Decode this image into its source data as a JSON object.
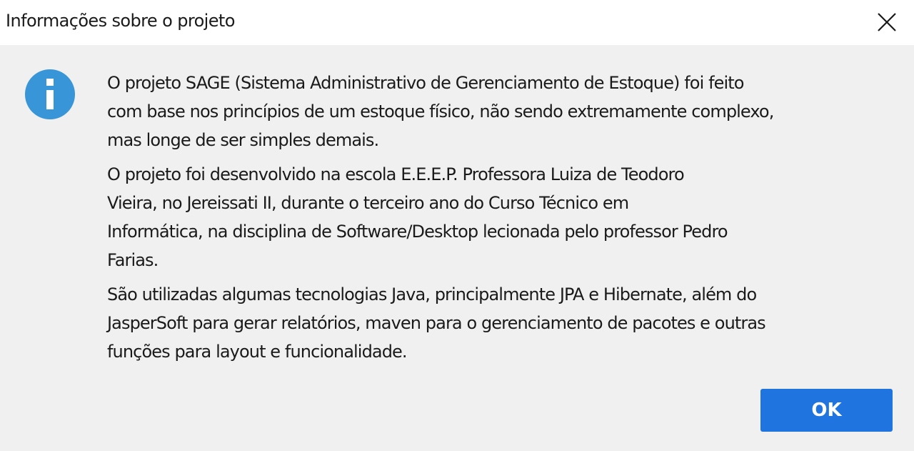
{
  "window": {
    "title": "Informações sobre o projeto"
  },
  "icons": {
    "close": "close-icon",
    "info": "info-icon"
  },
  "colors": {
    "info_icon": "#3795d8",
    "button": "#1f74e0",
    "background": "#f0f0f0",
    "titlebar": "#ffffff"
  },
  "message": {
    "paragraphs": [
      {
        "lines": [
          "O projeto SAGE (Sistema Administrativo de Gerenciamento de Estoque) foi feito",
          "com base nos princípios de um estoque físico, não sendo extremamente complexo,",
          "mas longe de ser simples demais."
        ]
      },
      {
        "lines": [
          "O projeto foi desenvolvido na escola E.E.E.P. Professora Luiza de Teodoro",
          "Vieira, no Jereissati II, durante o terceiro ano do Curso Técnico em",
          "Informática, na disciplina de Software/Desktop lecionada pelo professor Pedro",
          "Farias."
        ]
      },
      {
        "lines": [
          "São utilizadas algumas tecnologias Java, principalmente JPA e Hibernate, além do",
          "JasperSoft para gerar relatórios, maven para o gerenciamento de pacotes e outras",
          "funções para layout e funcionalidade."
        ]
      }
    ]
  },
  "buttons": {
    "ok_label": "OK"
  }
}
